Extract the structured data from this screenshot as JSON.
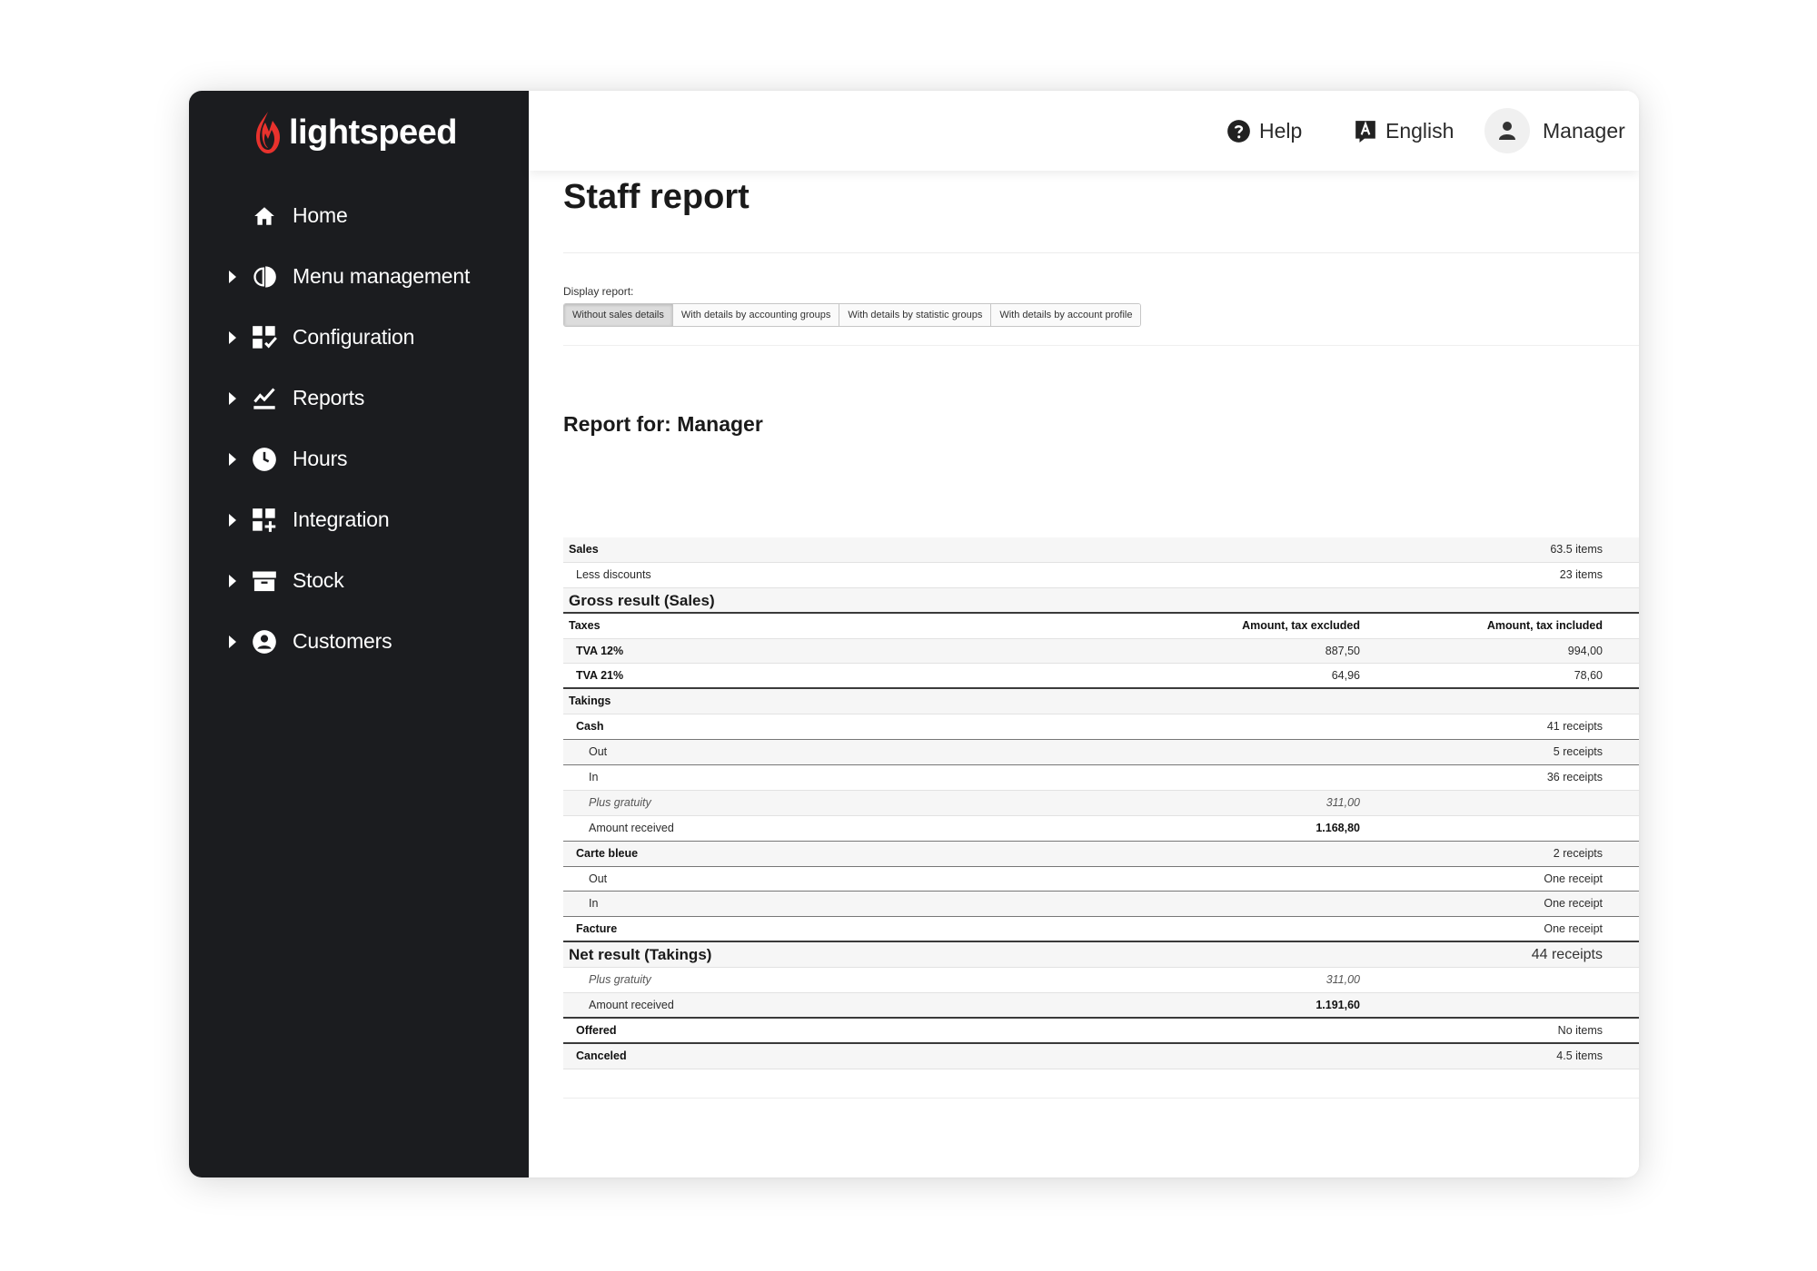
{
  "sidebar": {
    "logo_text": "lightspeed",
    "brand_color": "#e8322d",
    "items": [
      {
        "label": "Home",
        "icon": "home-icon",
        "expandable": false
      },
      {
        "label": "Menu management",
        "icon": "pie-chart-icon",
        "expandable": true
      },
      {
        "label": "Configuration",
        "icon": "grid-check-icon",
        "expandable": true
      },
      {
        "label": "Reports",
        "icon": "chart-line-icon",
        "expandable": true
      },
      {
        "label": "Hours",
        "icon": "clock-icon",
        "expandable": true
      },
      {
        "label": "Integration",
        "icon": "grid-plus-icon",
        "expandable": true
      },
      {
        "label": "Stock",
        "icon": "box-icon",
        "expandable": true
      },
      {
        "label": "Customers",
        "icon": "user-circle-icon",
        "expandable": true
      }
    ]
  },
  "topbar": {
    "help_label": "Help",
    "language_label": "English",
    "user_label": "Manager"
  },
  "page": {
    "title": "Staff report",
    "display_report_label": "Display report:",
    "display_options": [
      {
        "label": "Without sales details",
        "selected": true
      },
      {
        "label": "With details by accounting groups",
        "selected": false
      },
      {
        "label": "With details by statistic groups",
        "selected": false
      },
      {
        "label": "With details by account profile",
        "selected": false
      }
    ],
    "report_title": "Report for: Manager"
  },
  "report_rows": [
    {
      "label": "Sales",
      "right": "63.5 items",
      "style": "bold",
      "bg": "gray"
    },
    {
      "label": "Less discounts",
      "right": "23 items",
      "indent": 1,
      "bg": "white"
    },
    {
      "label": "Gross result (Sales)",
      "style": "big",
      "bg": "gray",
      "border": "thick"
    },
    {
      "label": "Taxes",
      "mid": "Amount, tax excluded",
      "right": "Amount, tax included",
      "style": "bold",
      "mid_bold": true,
      "right_bold": true,
      "bg": "white"
    },
    {
      "label": "TVA 12%",
      "mid": "887,50",
      "right": "994,00",
      "style": "bold",
      "indent": 1,
      "bg": "gray"
    },
    {
      "label": "TVA 21%",
      "mid": "64,96",
      "right": "78,60",
      "style": "bold",
      "indent": 1,
      "bg": "white",
      "border": "thick"
    },
    {
      "label": "Takings",
      "style": "bold",
      "bg": "gray"
    },
    {
      "label": "Cash",
      "right": "41 receipts",
      "style": "bold",
      "indent": 1,
      "bg": "white",
      "border": "mid"
    },
    {
      "label": "Out",
      "right": "5 receipts",
      "indent": 2,
      "bg": "gray",
      "border": "mid"
    },
    {
      "label": "In",
      "right": "36 receipts",
      "indent": 2,
      "bg": "white"
    },
    {
      "label": "Plus gratuity",
      "mid": "311,00",
      "style": "italic",
      "mid_italic": true,
      "indent": 2,
      "bg": "gray"
    },
    {
      "label": "Amount received",
      "mid": "1.168,80",
      "mid_bold": true,
      "indent": 2,
      "bg": "white",
      "border": "mid"
    },
    {
      "label": "Carte bleue",
      "right": "2 receipts",
      "style": "bold",
      "indent": 1,
      "bg": "gray",
      "border": "mid"
    },
    {
      "label": "Out",
      "right": "One receipt",
      "indent": 2,
      "bg": "white",
      "border": "mid"
    },
    {
      "label": "In",
      "right": "One receipt",
      "indent": 2,
      "bg": "gray",
      "border": "mid"
    },
    {
      "label": "Facture",
      "right": "One receipt",
      "style": "bold",
      "indent": 1,
      "bg": "white",
      "border": "thick"
    },
    {
      "label": "Net result (Takings)",
      "right": "44 receipts",
      "style": "big",
      "right_big": true,
      "bg": "gray"
    },
    {
      "label": "Plus gratuity",
      "mid": "311,00",
      "style": "italic",
      "mid_italic": true,
      "indent": 2,
      "bg": "white"
    },
    {
      "label": "Amount received",
      "mid": "1.191,60",
      "mid_bold": true,
      "indent": 2,
      "bg": "gray",
      "border": "thick"
    },
    {
      "label": "Offered",
      "right": "No items",
      "style": "bold",
      "indent": 1,
      "bg": "white",
      "border": "thick"
    },
    {
      "label": "Canceled",
      "right": "4.5 items",
      "style": "bold",
      "indent": 1,
      "bg": "gray"
    }
  ]
}
